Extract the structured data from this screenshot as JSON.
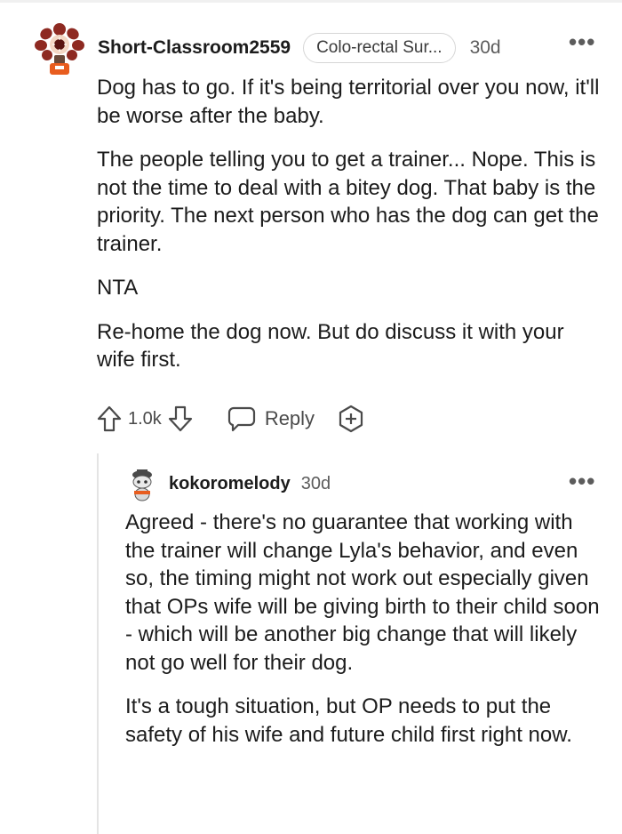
{
  "comment": {
    "username": "Short-Classroom2559",
    "flair": "Colo-rectal Sur...",
    "time": "30d",
    "more": "•••",
    "paragraphs": [
      "Dog has to go. If it's being territorial over you now, it'll be worse after the baby.",
      "The people telling you to get a trainer... Nope. This is not the time to deal with a bitey dog. That baby is the priority. The next person who has the dog can get the trainer.",
      "NTA",
      "Re-home the dog now. But do discuss it with your wife first."
    ],
    "votes": "1.0k",
    "reply_label": "Reply",
    "icons": {
      "avatar": "demogorgon-avatar-icon",
      "upvote": "upvote-arrow-icon",
      "downvote": "downvote-arrow-icon",
      "reply": "speech-bubble-icon",
      "award": "award-plus-icon"
    }
  },
  "reply": {
    "username": "kokoromelody",
    "time": "30d",
    "more": "•••",
    "paragraphs": [
      "Agreed - there's no guarantee that working with the trainer will change Lyla's behavior, and even so, the timing might not work out especially given that OPs wife will be giving birth to their child soon - which will be another big change that will likely not go well for their dog.",
      "It's a tough situation, but OP needs to put the safety of his wife and future child first right now."
    ],
    "icons": {
      "avatar": "snoo-avatar-icon"
    }
  },
  "colors": {
    "text": "#1c1c1c",
    "muted": "#5c5c5c",
    "thread_line": "#e4e4e4",
    "avatar_red": "#c0392b"
  }
}
